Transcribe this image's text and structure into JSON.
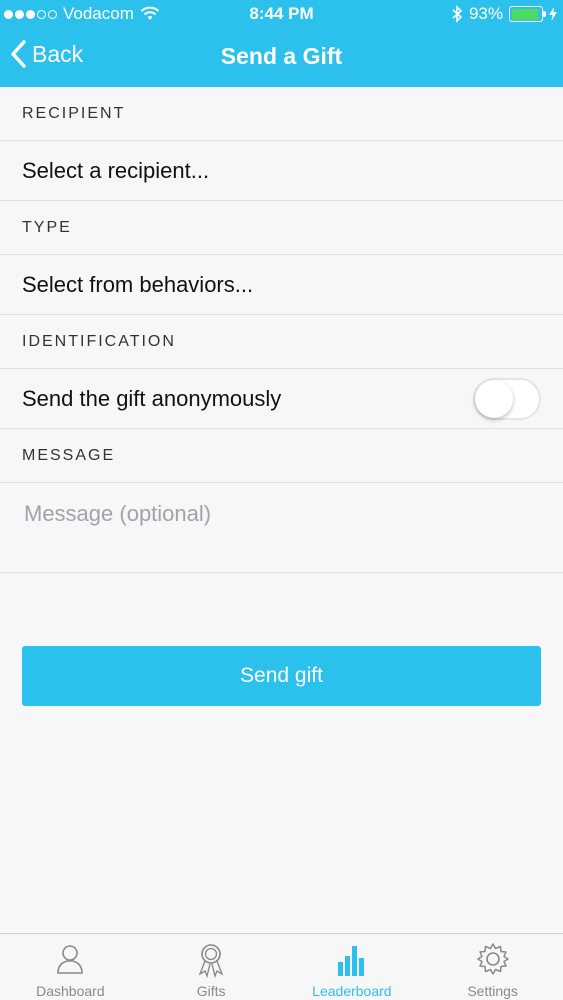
{
  "status_bar": {
    "carrier": "Vodacom",
    "time": "8:44 PM",
    "battery_percent": "93%",
    "battery_level": 0.93,
    "signal_bars_filled": 3,
    "signal_bars_total": 5
  },
  "nav": {
    "back_label": "Back",
    "title": "Send a Gift"
  },
  "form": {
    "recipient_header": "RECIPIENT",
    "recipient_value": "Select a recipient...",
    "type_header": "TYPE",
    "type_value": "Select from behaviors...",
    "identification_header": "IDENTIFICATION",
    "anonymous_label": "Send the gift anonymously",
    "anonymous_enabled": false,
    "message_header": "MESSAGE",
    "message_placeholder": "Message (optional)",
    "message_value": ""
  },
  "send_button_label": "Send gift",
  "tabs": [
    {
      "label": "Dashboard",
      "icon": "person-icon",
      "active": false
    },
    {
      "label": "Gifts",
      "icon": "award-ribbon-icon",
      "active": false
    },
    {
      "label": "Leaderboard",
      "icon": "bar-chart-icon",
      "active": true
    },
    {
      "label": "Settings",
      "icon": "gear-icon",
      "active": false
    }
  ],
  "colors": {
    "accent": "#2cc1ec",
    "battery": "#4cd964",
    "tab_inactive": "#8a8a8e"
  }
}
